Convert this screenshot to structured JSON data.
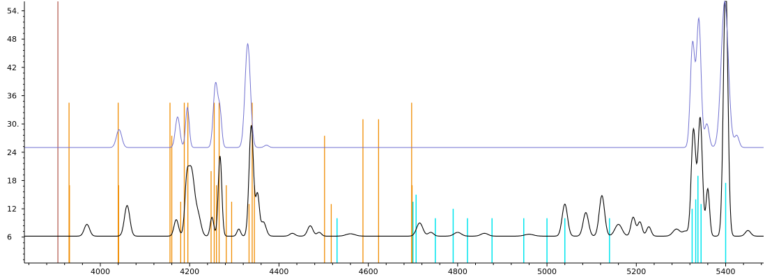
{
  "chart_data": {
    "type": "line",
    "title": "",
    "xlabel": "",
    "ylabel": "",
    "xlim": [
      3830,
      5485
    ],
    "ylim": [
      0.5,
      56
    ],
    "grid": false,
    "legend": "none",
    "x_ticks": [
      4000,
      4200,
      4400,
      4600,
      4800,
      5000,
      5200,
      5400
    ],
    "x_tick_labels": [
      "4000",
      "4200",
      "4400",
      "4600",
      "4800",
      "5000",
      "5200",
      "5400"
    ],
    "y_ticks": [
      6,
      12,
      18,
      24,
      30,
      36,
      42,
      48,
      54
    ],
    "y_tick_labels": [
      "6",
      "12",
      "18",
      "24",
      "30.",
      "36",
      "42",
      "48",
      "54."
    ],
    "colors": {
      "black_spectrum": "#000000",
      "blue_spectrum": "#7070d0",
      "marker_dark_red": "#a03020",
      "lines_orange": "#f08c00",
      "lines_cyan": "#00e5ee",
      "axis": "#000000"
    },
    "vertical_marker": {
      "x": 3905
    },
    "series": [
      {
        "baseline": 6.2,
        "peaks": [
          [
            3970,
            2.5,
            6
          ],
          [
            4060,
            6.5,
            6
          ],
          [
            4170,
            3.5,
            5
          ],
          [
            4193,
            6.5,
            4
          ],
          [
            4203,
            14.5,
            8
          ],
          [
            4220,
            3.5,
            6
          ],
          [
            4250,
            4,
            4
          ],
          [
            4268,
            17,
            4
          ],
          [
            4310,
            1.5,
            4
          ],
          [
            4338,
            23.5,
            5
          ],
          [
            4352,
            8.5,
            4
          ],
          [
            4365,
            3,
            6
          ],
          [
            4430,
            0.6,
            6
          ],
          [
            4470,
            2.2,
            6
          ],
          [
            4490,
            0.8,
            5
          ],
          [
            4560,
            0.5,
            10
          ],
          [
            4715,
            2.8,
            7
          ],
          [
            4740,
            0.8,
            6
          ],
          [
            4800,
            0.8,
            8
          ],
          [
            4860,
            0.6,
            8
          ],
          [
            4960,
            0.4,
            10
          ],
          [
            5040,
            6.8,
            6
          ],
          [
            5087,
            5,
            6
          ],
          [
            5123,
            8.6,
            6
          ],
          [
            5160,
            2.5,
            8
          ],
          [
            5193,
            4,
            5
          ],
          [
            5208,
            3,
            5
          ],
          [
            5228,
            2,
            5
          ],
          [
            5290,
            1.5,
            8
          ],
          [
            5310,
            1,
            6
          ],
          [
            5328,
            22.5,
            5
          ],
          [
            5343,
            25,
            5
          ],
          [
            5360,
            10,
            4
          ],
          [
            5400,
            54,
            5
          ],
          [
            5450,
            1.2,
            6
          ]
        ]
      },
      {
        "baseline": 25,
        "peaks": [
          [
            4042,
            3.8,
            6
          ],
          [
            4173,
            6.5,
            5
          ],
          [
            4195,
            8.5,
            4
          ],
          [
            4258,
            13.5,
            5
          ],
          [
            4268,
            7,
            4
          ],
          [
            4330,
            22,
            6
          ],
          [
            4372,
            0.5,
            5
          ],
          [
            5326,
            22,
            5
          ],
          [
            5340,
            27,
            5
          ],
          [
            5358,
            5,
            5
          ],
          [
            5398,
            31,
            8
          ],
          [
            5425,
            2.5,
            5
          ]
        ]
      }
    ],
    "orange_lines": [
      [
        3930,
        34.5
      ],
      [
        3931,
        17
      ],
      [
        4040,
        34.5
      ],
      [
        4041,
        17
      ],
      [
        4156,
        34.5
      ],
      [
        4160,
        27.5
      ],
      [
        4180,
        13.5
      ],
      [
        4188,
        34.5
      ],
      [
        4196,
        34.5
      ],
      [
        4248,
        20
      ],
      [
        4255,
        34.5
      ],
      [
        4260,
        17
      ],
      [
        4266,
        34.5
      ],
      [
        4282,
        17
      ],
      [
        4294,
        13.5
      ],
      [
        4333,
        13
      ],
      [
        4340,
        34.5
      ],
      [
        4345,
        17
      ],
      [
        4502,
        27.5
      ],
      [
        4517,
        13
      ],
      [
        4588,
        31
      ],
      [
        4623,
        31
      ],
      [
        4697,
        34.5
      ],
      [
        4698,
        17
      ]
    ],
    "cyan_lines": [
      [
        4530,
        10
      ],
      [
        4700,
        13.5
      ],
      [
        4707,
        15
      ],
      [
        4750,
        10
      ],
      [
        4790,
        12
      ],
      [
        4822,
        10
      ],
      [
        4877,
        10
      ],
      [
        4948,
        10
      ],
      [
        5000,
        10
      ],
      [
        5040,
        10
      ],
      [
        5140,
        10
      ],
      [
        5325,
        12
      ],
      [
        5333,
        14
      ],
      [
        5338,
        19
      ],
      [
        5345,
        13
      ],
      [
        5400,
        17.5
      ]
    ]
  }
}
